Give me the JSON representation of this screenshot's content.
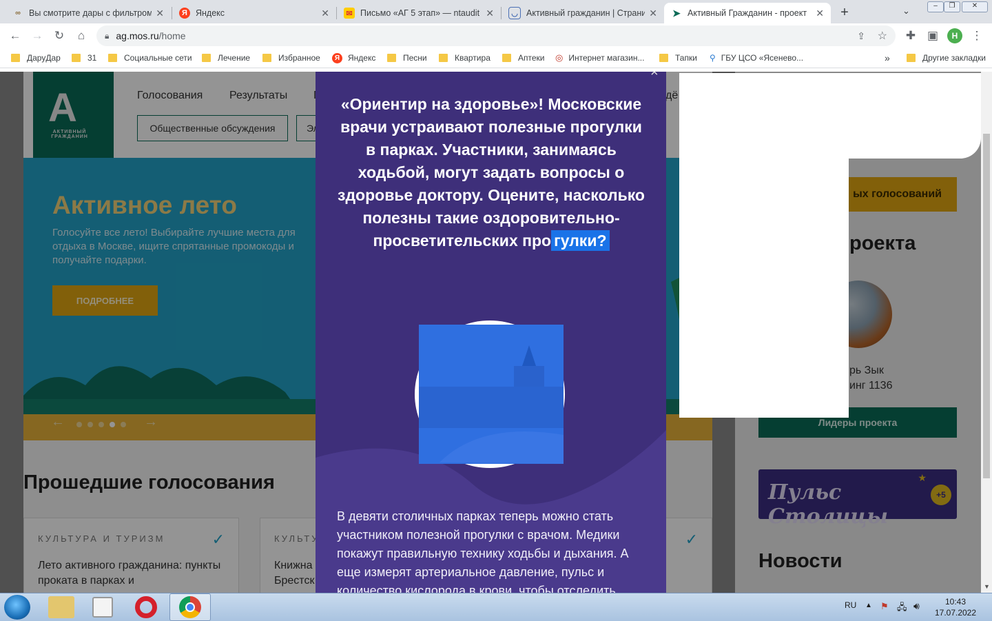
{
  "browser": {
    "tabs": [
      {
        "title": "Вы смотрите дары с фильтром",
        "favicon": "link-icon",
        "active": false
      },
      {
        "title": "Яндекс",
        "favicon": "yandex-icon",
        "active": false
      },
      {
        "title": "Письмо «АГ 5 этап» — ntaudit",
        "favicon": "mail-icon",
        "active": false
      },
      {
        "title": "Активный гражданин | Страниц",
        "favicon": "shield-icon",
        "active": false
      },
      {
        "title": "Активный Гражданин - проект",
        "favicon": "ag-icon",
        "active": true
      }
    ],
    "new_tab": "+",
    "url_host": "ag.mos.ru",
    "url_path": "/home",
    "profile_initial": "Н",
    "bookmarks": [
      "ДаруДар",
      "31",
      "Социальные сети",
      "Лечение",
      "Избранное",
      "Яндекс",
      "Песни",
      "Квартира",
      "Аптеки",
      "Интернет магазин...",
      "Тапки",
      "ГБУ ЦСО «Ясенево..."
    ],
    "more_bookmarks": "»",
    "other_bookmarks": "Другие закладки"
  },
  "site": {
    "logo_line1": "АКТИВНЫЙ",
    "logo_line2": "ГРАЖДАНИН",
    "nav": [
      "Голосования",
      "Результаты",
      "Г"
    ],
    "nav_right": "дё",
    "subnav": [
      "Общественные обсуждения",
      "Эл"
    ],
    "hero_title": "Активное лето",
    "hero_text": "Голосуйте все лето! Выбирайте лучшие места для отдыха в Москве, ищите спрятанные промокоды и получайте подарки.",
    "hero_button": "ПОДРОБНЕЕ",
    "past_votes_title": "Прошедшие голосования",
    "card1_category": "КУЛЬТУРА И ТУРИЗМ",
    "card1_title": "Лето активного гражданина: пункты проката в парках и",
    "card2_category": "КУЛЬТУ",
    "card2_title": "Книжна Брестск",
    "side_button": "ых голосований",
    "side_heading": "роекта",
    "side_name": "рь Зык",
    "side_rating": "инг 1136",
    "leaders_button": "Лидеры проекта",
    "pulse_banner": "Пульс Столицы",
    "pulse_badge": "+5",
    "news_title": "Новости"
  },
  "modal": {
    "close": "×",
    "headline_main": "«Ориентир на здоровье»! Московские врачи устраивают полезные прогулки в парках. Участники, занимаясь ходьбой, могут задать вопросы о здоровье доктору. Оцените, насколько полезны такие оздоровительно-просветительских про",
    "headline_selected": "гулки?",
    "body": "В девяти столичных парках теперь можно стать участником полезной прогулки с врачом. Медики покажут правильную технику ходьбы и дыхания. А еще измерят артериальное давление, пульс и количество кислорода в крови, чтобы отследить"
  },
  "taskbar": {
    "lang": "RU",
    "time": "10:43",
    "date": "17.07.2022"
  },
  "colors": {
    "ag_green": "#0a6b57",
    "modal_purple": "#3e2f7a",
    "selection_blue": "#1a73e8",
    "hero_button": "#e0a612"
  }
}
